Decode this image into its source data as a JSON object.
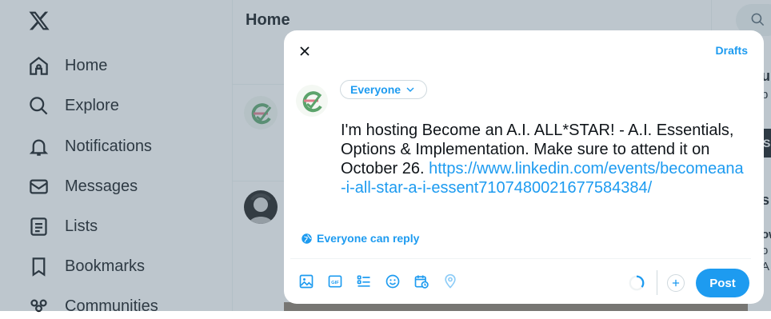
{
  "nav": {
    "items": [
      {
        "label": "Home",
        "icon": "home-icon"
      },
      {
        "label": "Explore",
        "icon": "search-icon"
      },
      {
        "label": "Notifications",
        "icon": "bell-icon"
      },
      {
        "label": "Messages",
        "icon": "envelope-icon"
      },
      {
        "label": "Lists",
        "icon": "list-icon"
      },
      {
        "label": "Bookmarks",
        "icon": "bookmark-icon"
      },
      {
        "label": "Communities",
        "icon": "communities-icon"
      }
    ]
  },
  "main": {
    "title": "Home"
  },
  "right": {
    "fragments": [
      "u",
      "b",
      "S",
      "s",
      "ow",
      "o",
      "A"
    ]
  },
  "compose": {
    "drafts_label": "Drafts",
    "audience_label": "Everyone",
    "text": "I'm hosting Become an A.I. ALL*STAR! - A.I. Essentials, Options & Implementation. Make sure to attend it on October 26.",
    "link": "https://www.linkedin.com/events/becomeana-i-all-star-a-i-essent7107480021677584384/",
    "reply_setting": "Everyone can reply",
    "post_label": "Post",
    "toolbar_icons": [
      "media-icon",
      "gif-icon",
      "poll-icon",
      "emoji-icon",
      "schedule-icon",
      "location-icon"
    ]
  },
  "colors": {
    "accent": "#1d9bf0",
    "overlay": "rgba(91,112,131,0.4)",
    "text": "#0f1419"
  }
}
